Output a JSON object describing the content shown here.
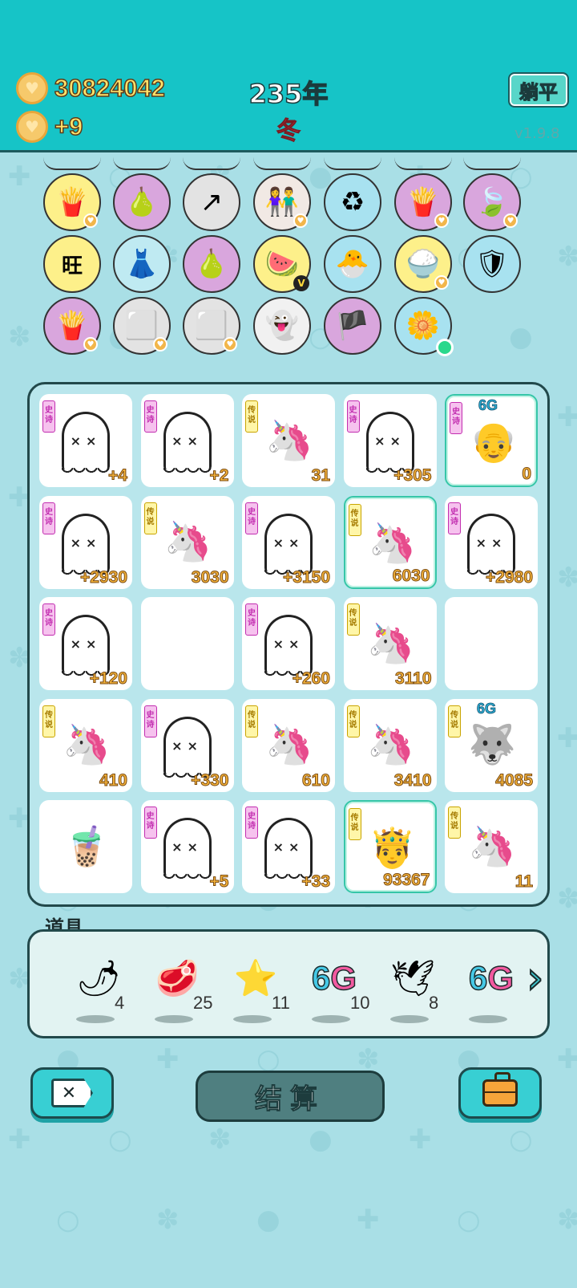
{
  "header": {
    "coins": "30824042",
    "income": "+9",
    "year": "235年",
    "season": "冬",
    "flat_button": "躺平",
    "version": "v1.9.8"
  },
  "colors": {
    "topbar": "#16c4c7",
    "background": "#a9dfe6",
    "value_text": "#f6b43a",
    "epic_tag": "#c22eb0",
    "legend_tag": "#c9a400"
  },
  "owned_items": [
    {
      "icon": "fries-icon",
      "glyph": "🍟",
      "bg": "#fdf08a",
      "badge": true
    },
    {
      "icon": "pomelo-icon",
      "glyph": "🍐",
      "bg": "#d9a6dd",
      "badge": false
    },
    {
      "icon": "arrow-card-icon",
      "glyph": "↗",
      "bg": "#e3e3e3",
      "badge": false
    },
    {
      "icon": "couple-icon",
      "glyph": "👫",
      "bg": "#f1e9e4",
      "badge": true
    },
    {
      "icon": "trash-bag-icon",
      "glyph": "♻",
      "bg": "#a8e2f0",
      "badge": false
    },
    {
      "icon": "fries-icon",
      "glyph": "🍟",
      "bg": "#d9a6dd",
      "badge": true
    },
    {
      "icon": "leaf-icon",
      "glyph": "🍃",
      "bg": "#d9a6dd",
      "badge": true
    },
    {
      "icon": "wangwang-icon",
      "glyph": "旺",
      "bg": "#fdf08a",
      "badge": false
    },
    {
      "icon": "skirt-icon",
      "glyph": "👗",
      "bg": "#bfeaf2",
      "badge": false
    },
    {
      "icon": "pomelo-icon",
      "glyph": "🍐",
      "bg": "#d9a6dd",
      "badge": false
    },
    {
      "icon": "fruit-bowl-icon",
      "glyph": "🍉",
      "bg": "#fdf08a",
      "badge": false,
      "vip": "V"
    },
    {
      "icon": "chick-icon",
      "glyph": "🐣",
      "bg": "#a8e2f0",
      "badge": false
    },
    {
      "icon": "rice-bowl-icon",
      "glyph": "🍚",
      "bg": "#fdf08a",
      "badge": true
    },
    {
      "icon": "shield-icon",
      "glyph": "🛡",
      "bg": "#a8e2f0",
      "badge": false
    },
    {
      "icon": "fries-icon",
      "glyph": "🍟",
      "bg": "#d9a6dd",
      "badge": true
    },
    {
      "icon": "sugar-cubes-icon",
      "glyph": "⬜",
      "bg": "#e3e3e3",
      "badge": true
    },
    {
      "icon": "sugar-cubes-icon",
      "glyph": "⬜",
      "bg": "#e3e3e3",
      "badge": true
    },
    {
      "icon": "ghost-tongue-icon",
      "glyph": "👻",
      "bg": "#f1f1f1",
      "badge": false
    },
    {
      "icon": "eyepatch-icon",
      "glyph": "🏴",
      "bg": "#d9a6dd",
      "badge": false
    },
    {
      "icon": "flower-pot-icon",
      "glyph": "🌼",
      "bg": "#a8e2f0",
      "badge": false,
      "dot": true
    }
  ],
  "grid": [
    {
      "tag": "史诗",
      "tag_type": "epic",
      "sprite": "ghost",
      "value": "+4"
    },
    {
      "tag": "史诗",
      "tag_type": "epic",
      "sprite": "ghost",
      "value": "+2"
    },
    {
      "tag": "传说",
      "tag_type": "legend",
      "sprite": "unicorn",
      "value": "31"
    },
    {
      "tag": "史诗",
      "tag_type": "epic",
      "sprite": "ghost",
      "value": "+305"
    },
    {
      "tag": "史诗",
      "tag_type": "epic",
      "sprite": "old-man",
      "value": "0",
      "g6": "6G",
      "highlight": true
    },
    {
      "tag": "史诗",
      "tag_type": "epic",
      "sprite": "ghost",
      "value": "+2930"
    },
    {
      "tag": "传说",
      "tag_type": "legend",
      "sprite": "unicorn",
      "value": "3030"
    },
    {
      "tag": "史诗",
      "tag_type": "epic",
      "sprite": "ghost",
      "value": "+3150"
    },
    {
      "tag": "传说",
      "tag_type": "legend",
      "sprite": "unicorn",
      "value": "6030",
      "highlight": true
    },
    {
      "tag": "史诗",
      "tag_type": "epic",
      "sprite": "ghost",
      "value": "+2980"
    },
    {
      "tag": "史诗",
      "tag_type": "epic",
      "sprite": "ghost",
      "value": "+120"
    },
    {
      "tag": "",
      "tag_type": "",
      "sprite": "",
      "value": ""
    },
    {
      "tag": "史诗",
      "tag_type": "epic",
      "sprite": "ghost",
      "value": "+260"
    },
    {
      "tag": "传说",
      "tag_type": "legend",
      "sprite": "unicorn",
      "value": "3110"
    },
    {
      "tag": "",
      "tag_type": "",
      "sprite": "",
      "value": ""
    },
    {
      "tag": "传说",
      "tag_type": "legend",
      "sprite": "unicorn",
      "value": "410"
    },
    {
      "tag": "史诗",
      "tag_type": "epic",
      "sprite": "ghost",
      "value": "+330"
    },
    {
      "tag": "传说",
      "tag_type": "legend",
      "sprite": "unicorn",
      "value": "610"
    },
    {
      "tag": "传说",
      "tag_type": "legend",
      "sprite": "unicorn",
      "value": "3410"
    },
    {
      "tag": "传说",
      "tag_type": "legend",
      "sprite": "husky",
      "value": "4085",
      "g6": "6G"
    },
    {
      "tag": "",
      "tag_type": "",
      "sprite": "bubble-tea",
      "value": ""
    },
    {
      "tag": "史诗",
      "tag_type": "epic",
      "sprite": "ghost",
      "value": "+5"
    },
    {
      "tag": "史诗",
      "tag_type": "epic",
      "sprite": "ghost",
      "value": "+33"
    },
    {
      "tag": "传说",
      "tag_type": "legend",
      "sprite": "grinning-king",
      "value": "93367",
      "highlight": true
    },
    {
      "tag": "传说",
      "tag_type": "legend",
      "sprite": "unicorn",
      "value": "11"
    }
  ],
  "props": {
    "label": "道具",
    "items": [
      {
        "icon": "chili-pepper-icon",
        "glyph": "🌶",
        "count": "4"
      },
      {
        "icon": "liver-icon",
        "glyph": "🥩",
        "count": "25"
      },
      {
        "icon": "star-icon",
        "glyph": "⭐",
        "count": "11"
      },
      {
        "icon": "6g-icon",
        "glyph": "6G",
        "count": "10"
      },
      {
        "icon": "goose-icon",
        "glyph": "🕊",
        "count": "8"
      },
      {
        "icon": "6g-icon",
        "glyph": "6G",
        "count": ""
      }
    ]
  },
  "bottom": {
    "settle_label": "结算"
  }
}
